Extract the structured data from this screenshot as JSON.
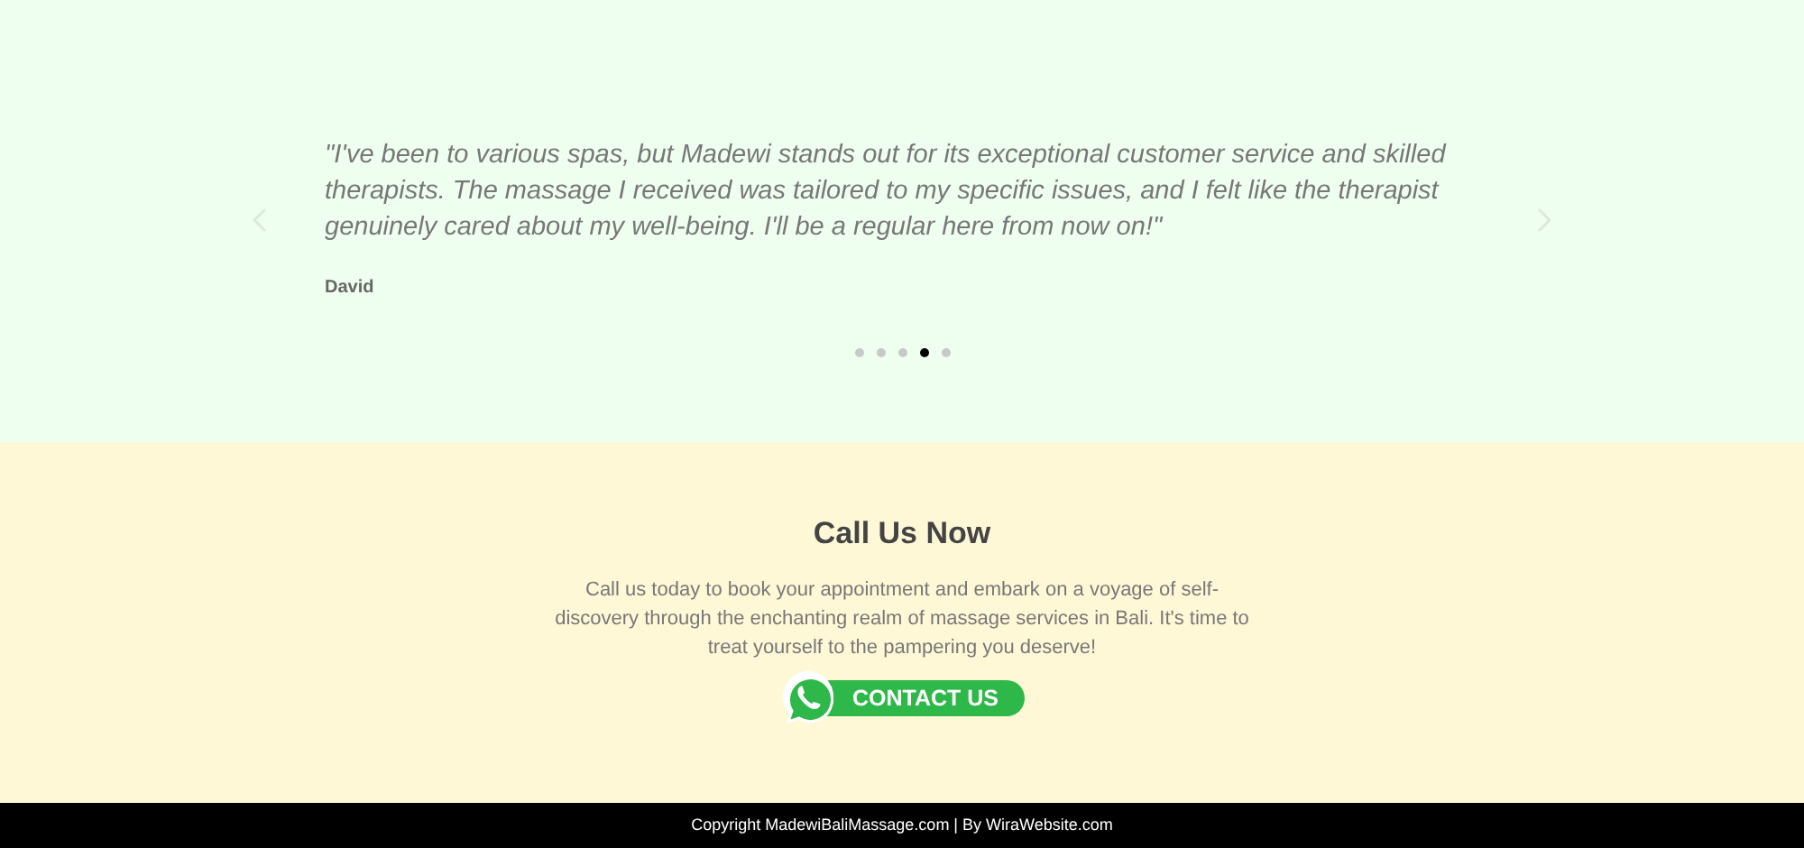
{
  "testimonial": {
    "quote": "\"I've been to various spas, but Madewi stands out for its exceptional customer service and skilled therapists. The massage I received was tailored to my specific issues, and I felt like the therapist genuinely cared about my well-being. I'll be a regular here from now on!\"",
    "author": "David",
    "dots": [
      {
        "selected": false
      },
      {
        "selected": false
      },
      {
        "selected": false
      },
      {
        "selected": true
      },
      {
        "selected": false
      }
    ]
  },
  "call": {
    "title": "Call Us Now",
    "text": "Call us today to book your appointment and embark on a voyage of self-discovery through the enchanting realm of massage services in Bali. It's time to treat yourself to the pampering you deserve!",
    "button": "CONTACT US"
  },
  "footer": "Copyright MadewiBaliMassage.com | By WiraWebsite.com"
}
